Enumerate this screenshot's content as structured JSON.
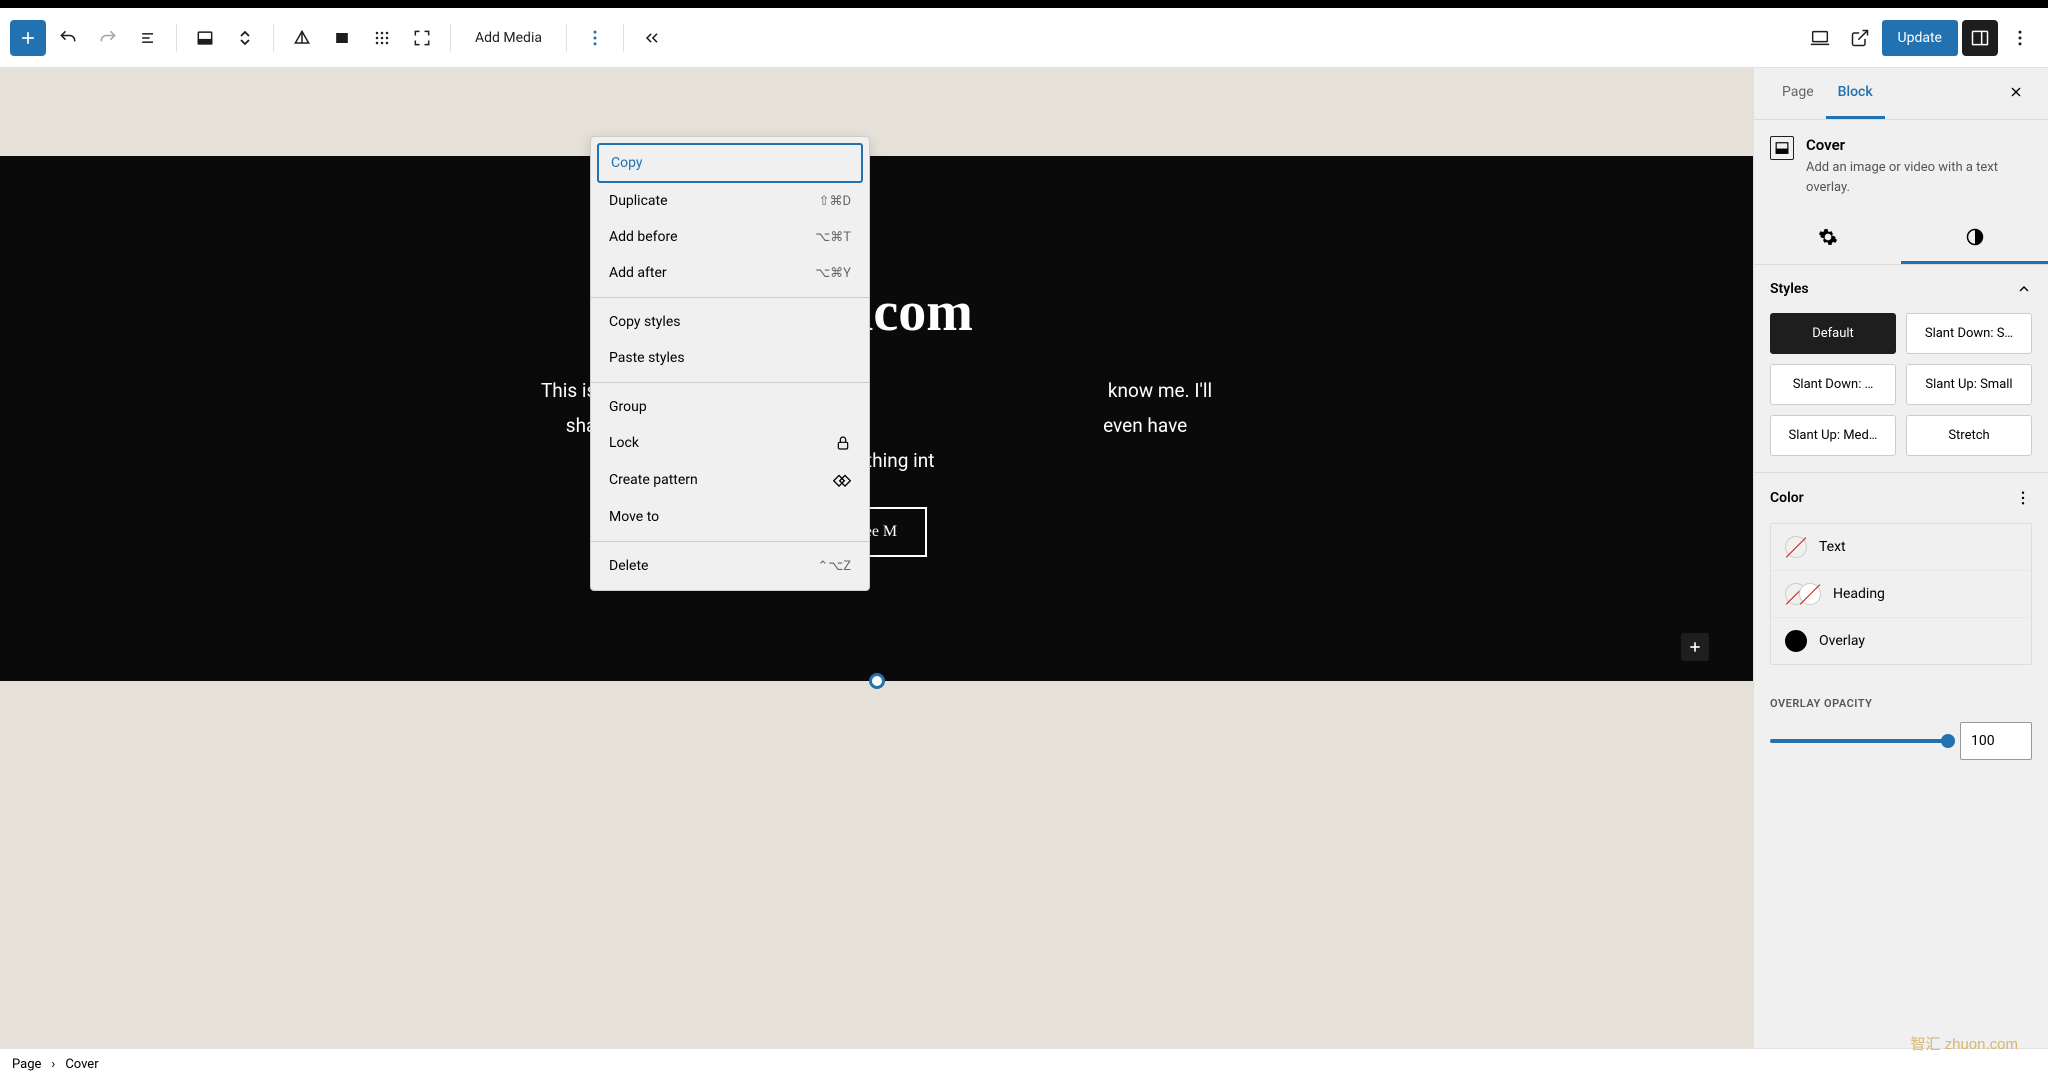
{
  "toolbar": {
    "add_media_label": "Add Media",
    "update_label": "Update"
  },
  "context_menu": {
    "sections": [
      {
        "items": [
          {
            "label": "Copy",
            "shortcut": "",
            "active": true
          },
          {
            "label": "Duplicate",
            "shortcut": "⇧⌘D"
          },
          {
            "label": "Add before",
            "shortcut": "⌥⌘T"
          },
          {
            "label": "Add after",
            "shortcut": "⌥⌘Y"
          }
        ]
      },
      {
        "items": [
          {
            "label": "Copy styles",
            "shortcut": ""
          },
          {
            "label": "Paste styles",
            "shortcut": ""
          }
        ]
      },
      {
        "items": [
          {
            "label": "Group",
            "shortcut": ""
          },
          {
            "label": "Lock",
            "icon": "lock"
          },
          {
            "label": "Create pattern",
            "icon": "pattern"
          },
          {
            "label": "Move to",
            "shortcut": ""
          }
        ]
      },
      {
        "items": [
          {
            "label": "Delete",
            "shortcut": "⌃⌥Z"
          }
        ]
      }
    ]
  },
  "cover": {
    "title_visible": "Welcom",
    "text_line1": "This is my little home away fron",
    "text_line1_after": "know me.  I'll",
    "text_line2": "share my likes, hobbies, and r",
    "text_line2_after": "even have",
    "text_line3": "something int",
    "button_label": "See M"
  },
  "sidebar": {
    "tabs": {
      "page": "Page",
      "block": "Block"
    },
    "block": {
      "name": "Cover",
      "desc": "Add an image or video with a text overlay."
    },
    "styles": {
      "heading": "Styles",
      "items": [
        "Default",
        "Slant Down: S…",
        "Slant Down: …",
        "Slant Up: Small",
        "Slant Up: Med…",
        "Stretch"
      ]
    },
    "color": {
      "heading": "Color",
      "items": [
        {
          "label": "Text",
          "swatch": "empty"
        },
        {
          "label": "Heading",
          "swatch": "empty-pair"
        },
        {
          "label": "Overlay",
          "swatch": "#000000"
        }
      ]
    },
    "overlay_opacity": {
      "label": "OVERLAY OPACITY",
      "value": "100"
    }
  },
  "breadcrumb": {
    "root": "Page",
    "current": "Cover"
  },
  "watermark": "智汇 zhuon.com"
}
